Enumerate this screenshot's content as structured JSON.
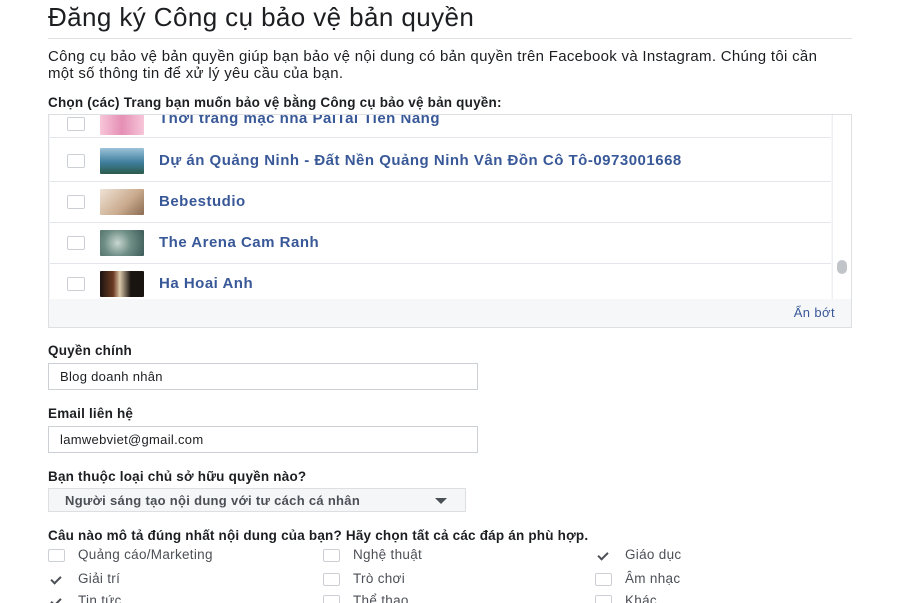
{
  "header": {
    "title": "Đăng ký Công cụ bảo vệ bản quyền"
  },
  "intro": "Công cụ bảo vệ bản quyền giúp bạn bảo vệ nội dung có bản quyền trên Facebook và Instagram. Chúng tôi cần một số thông tin để xử lý yêu cầu của bạn.",
  "pages_section": {
    "label": "Chọn (các) Trang bạn muốn bảo vệ bằng Công cụ bảo vệ bản quyền:",
    "pages": [
      {
        "name": "Thời trang mặc nhà PaiTai Tiến Năng",
        "checked": false,
        "thumb_color": "#f2a6c4"
      },
      {
        "name": "Dự án Quảng Ninh - Đất Nền Quảng Ninh Vân Đồn Cô Tô-0973001668",
        "checked": false,
        "thumb_color": "#5b8fa8"
      },
      {
        "name": "Bebestudio",
        "checked": false,
        "thumb_color": "#d8c2ad"
      },
      {
        "name": "The Arena Cam Ranh",
        "checked": false,
        "thumb_color": "#7d9a8a"
      },
      {
        "name": "Ha Hoai Anh",
        "checked": false,
        "thumb_color": "#3a2a22"
      }
    ],
    "collapse_label": "Ẩn bớt"
  },
  "owner_field": {
    "label": "Quyền chính",
    "value": "Blog doanh nhân"
  },
  "email_field": {
    "label": "Email liên hệ",
    "value": "lamwebviet@gmail.com"
  },
  "owner_type": {
    "label": "Bạn thuộc loại chủ sở hữu quyền nào?",
    "selected": "Người sáng tạo nội dung với tư cách cá nhân"
  },
  "content_type": {
    "label": "Câu nào mô tả đúng nhất nội dung của bạn? Hãy chọn tất cả các đáp án phù hợp.",
    "options": [
      {
        "label": "Quảng cáo/Marketing",
        "checked": false
      },
      {
        "label": "Nghệ thuật",
        "checked": false
      },
      {
        "label": "Giáo dục",
        "checked": true
      },
      {
        "label": "Giải trí",
        "checked": true
      },
      {
        "label": "Trò chơi",
        "checked": false
      },
      {
        "label": "Âm nhạc",
        "checked": false
      },
      {
        "label": "Tin tức",
        "checked": true
      },
      {
        "label": "Thể thao",
        "checked": false
      },
      {
        "label": "Khác",
        "checked": false
      }
    ]
  }
}
